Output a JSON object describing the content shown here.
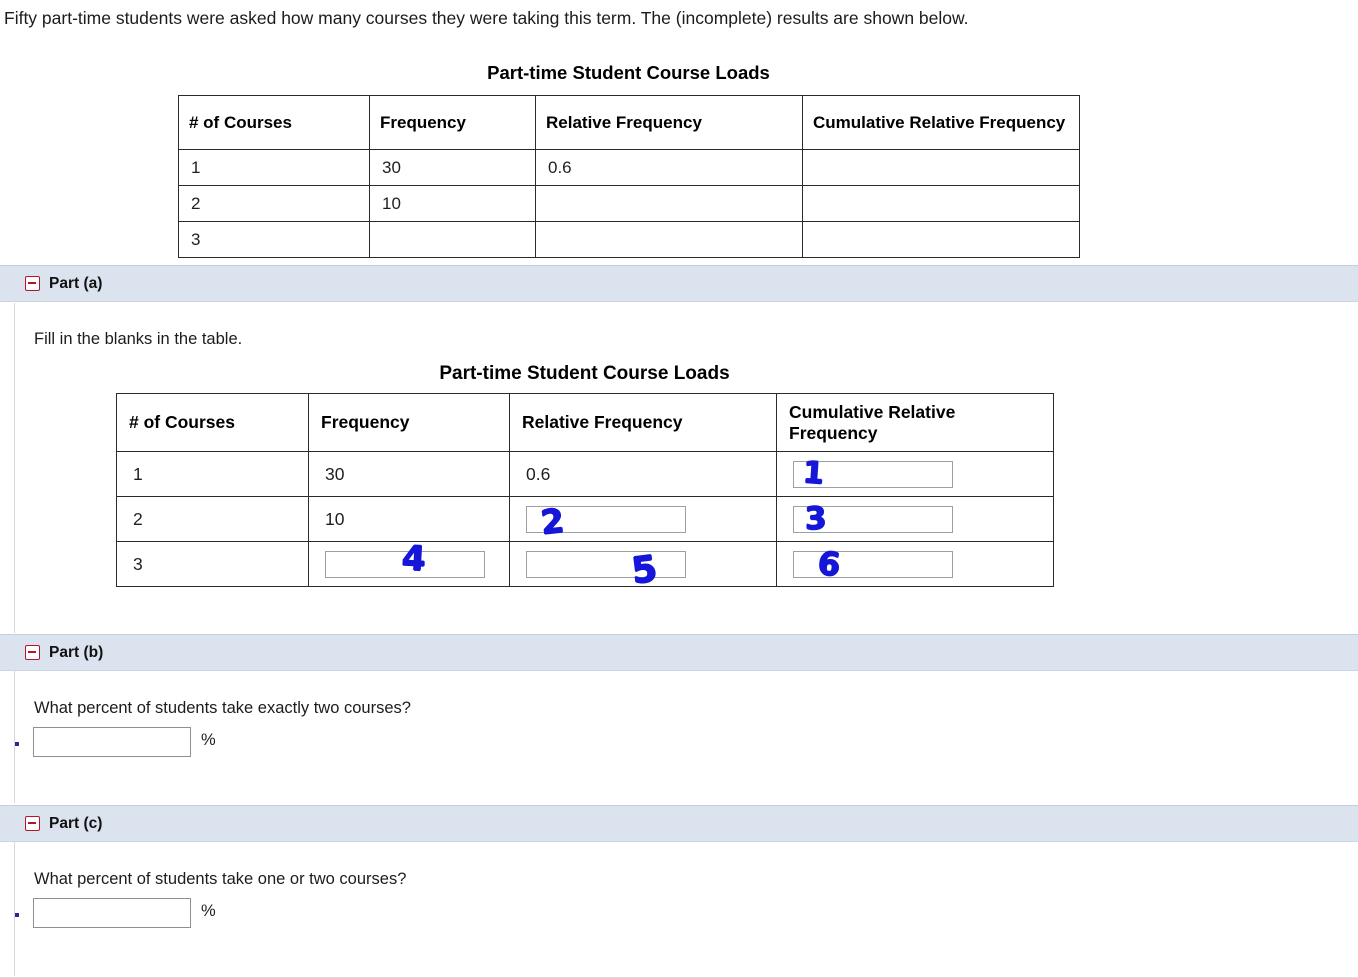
{
  "intro": "Fifty part-time students were asked how many courses they were taking this term. The (incomplete) results are shown below.",
  "table1": {
    "title": "Part-time Student Course Loads",
    "headers": [
      "# of Courses",
      "Frequency",
      "Relative Frequency",
      "Cumulative Relative Frequency"
    ],
    "rows": [
      {
        "courses": "1",
        "frequency": "30",
        "relative_frequency": "0.6",
        "cumulative_relative_frequency": ""
      },
      {
        "courses": "2",
        "frequency": "10",
        "relative_frequency": "",
        "cumulative_relative_frequency": ""
      },
      {
        "courses": "3",
        "frequency": "",
        "relative_frequency": "",
        "cumulative_relative_frequency": ""
      }
    ]
  },
  "parts": {
    "a": {
      "label": "Part (a)",
      "icon": "minus-square-icon",
      "prompt": "Fill in the blanks in the table.",
      "table": {
        "title": "Part-time Student Course Loads",
        "headers": [
          "# of Courses",
          "Frequency",
          "Relative Frequency",
          "Cumulative Relative Frequency"
        ],
        "rows": [
          {
            "courses": "1",
            "frequency": "30",
            "relative_frequency": "0.6",
            "cumulative_relative_frequency": ""
          },
          {
            "courses": "2",
            "frequency": "10",
            "relative_frequency": "",
            "cumulative_relative_frequency": ""
          },
          {
            "courses": "3",
            "frequency": "",
            "relative_frequency": "",
            "cumulative_relative_frequency": ""
          }
        ]
      },
      "handwriting": {
        "row1_cumulative": "1",
        "row2_relative": "2",
        "row2_cumulative": "3",
        "row3_frequency": "4",
        "row3_relative": "5",
        "row3_cumulative": "6"
      }
    },
    "b": {
      "label": "Part (b)",
      "icon": "minus-square-icon",
      "question": "What percent of students take exactly two courses?",
      "answer_value": "",
      "unit": "%"
    },
    "c": {
      "label": "Part (c)",
      "icon": "minus-square-icon",
      "question": "What percent of students take one or two courses?",
      "answer_value": "",
      "unit": "%"
    }
  },
  "colors": {
    "given_value_red": "#cc2b26",
    "handwriting_blue": "#1616d8",
    "part_bar_bg": "#dbe4ee",
    "icon_red": "#b3152b"
  }
}
